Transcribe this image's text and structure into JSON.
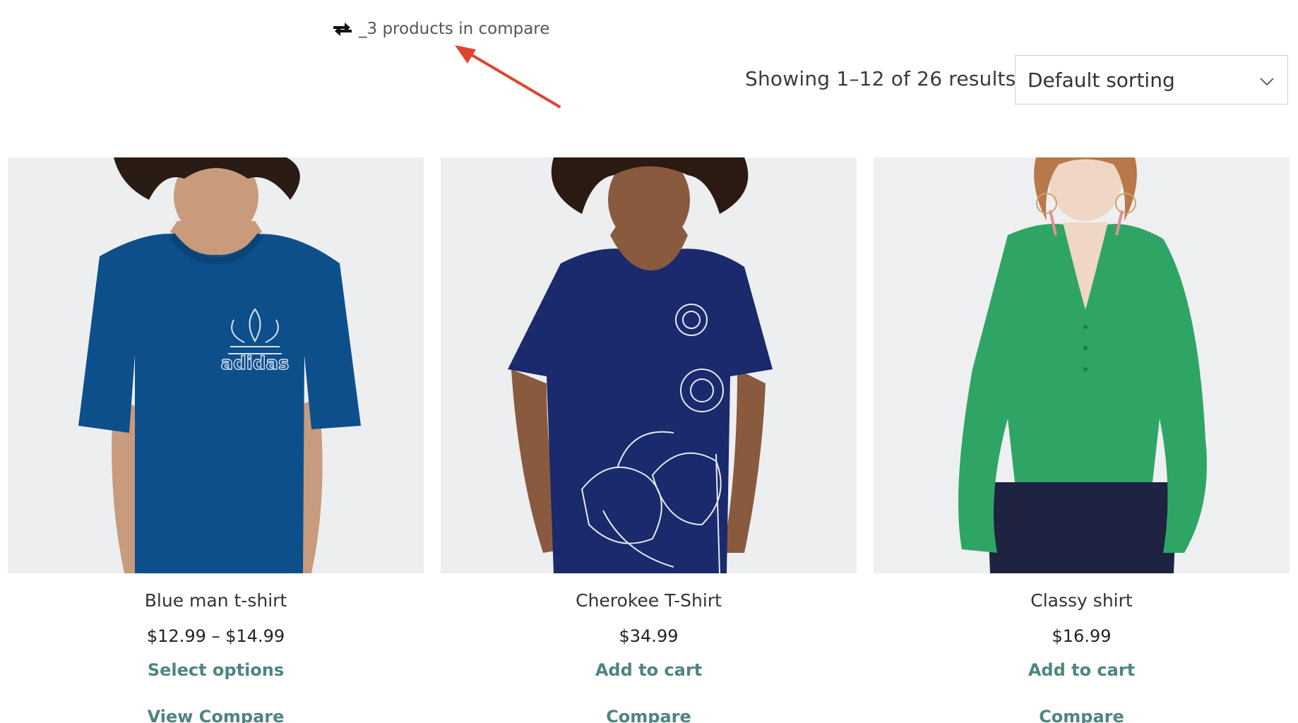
{
  "compare_notice": {
    "icon": "compare-arrows-icon",
    "text": "_3 products in compare"
  },
  "results": {
    "count_text": "Showing 1–12 of 26 results"
  },
  "sorting": {
    "selected": "Default sorting",
    "icon": "chevron-down-icon"
  },
  "colors": {
    "accent": "#4e8580",
    "annotation_arrow": "#e0442d"
  },
  "products": [
    {
      "title": "Blue man t-shirt",
      "price": "$12.99 – $14.99",
      "action": "Select options",
      "compare": "View Compare",
      "garment_color": "#0d4f8b"
    },
    {
      "title": "Cherokee T-Shirt",
      "price": "$34.99",
      "action": "Add to cart",
      "compare": "Compare",
      "garment_color": "#1a2a6c"
    },
    {
      "title": "Classy shirt",
      "price": "$16.99",
      "action": "Add to cart",
      "compare": "Compare",
      "garment_color": "#2fa565"
    }
  ]
}
